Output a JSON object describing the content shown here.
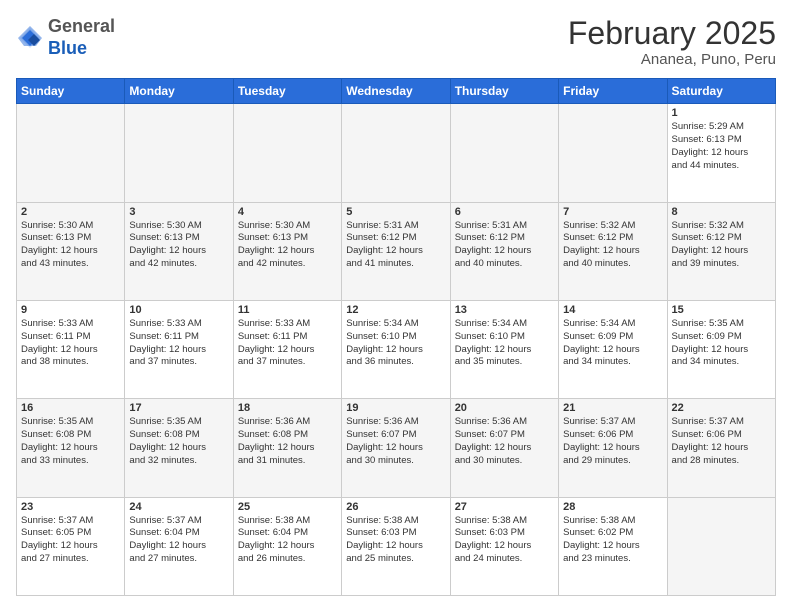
{
  "header": {
    "logo": {
      "general": "General",
      "blue": "Blue"
    },
    "title": "February 2025",
    "location": "Ananea, Puno, Peru"
  },
  "weekdays": [
    "Sunday",
    "Monday",
    "Tuesday",
    "Wednesday",
    "Thursday",
    "Friday",
    "Saturday"
  ],
  "weeks": [
    [
      {
        "day": "",
        "info": ""
      },
      {
        "day": "",
        "info": ""
      },
      {
        "day": "",
        "info": ""
      },
      {
        "day": "",
        "info": ""
      },
      {
        "day": "",
        "info": ""
      },
      {
        "day": "",
        "info": ""
      },
      {
        "day": "1",
        "info": "Sunrise: 5:29 AM\nSunset: 6:13 PM\nDaylight: 12 hours\nand 44 minutes."
      }
    ],
    [
      {
        "day": "2",
        "info": "Sunrise: 5:30 AM\nSunset: 6:13 PM\nDaylight: 12 hours\nand 43 minutes."
      },
      {
        "day": "3",
        "info": "Sunrise: 5:30 AM\nSunset: 6:13 PM\nDaylight: 12 hours\nand 42 minutes."
      },
      {
        "day": "4",
        "info": "Sunrise: 5:30 AM\nSunset: 6:13 PM\nDaylight: 12 hours\nand 42 minutes."
      },
      {
        "day": "5",
        "info": "Sunrise: 5:31 AM\nSunset: 6:12 PM\nDaylight: 12 hours\nand 41 minutes."
      },
      {
        "day": "6",
        "info": "Sunrise: 5:31 AM\nSunset: 6:12 PM\nDaylight: 12 hours\nand 40 minutes."
      },
      {
        "day": "7",
        "info": "Sunrise: 5:32 AM\nSunset: 6:12 PM\nDaylight: 12 hours\nand 40 minutes."
      },
      {
        "day": "8",
        "info": "Sunrise: 5:32 AM\nSunset: 6:12 PM\nDaylight: 12 hours\nand 39 minutes."
      }
    ],
    [
      {
        "day": "9",
        "info": "Sunrise: 5:33 AM\nSunset: 6:11 PM\nDaylight: 12 hours\nand 38 minutes."
      },
      {
        "day": "10",
        "info": "Sunrise: 5:33 AM\nSunset: 6:11 PM\nDaylight: 12 hours\nand 37 minutes."
      },
      {
        "day": "11",
        "info": "Sunrise: 5:33 AM\nSunset: 6:11 PM\nDaylight: 12 hours\nand 37 minutes."
      },
      {
        "day": "12",
        "info": "Sunrise: 5:34 AM\nSunset: 6:10 PM\nDaylight: 12 hours\nand 36 minutes."
      },
      {
        "day": "13",
        "info": "Sunrise: 5:34 AM\nSunset: 6:10 PM\nDaylight: 12 hours\nand 35 minutes."
      },
      {
        "day": "14",
        "info": "Sunrise: 5:34 AM\nSunset: 6:09 PM\nDaylight: 12 hours\nand 34 minutes."
      },
      {
        "day": "15",
        "info": "Sunrise: 5:35 AM\nSunset: 6:09 PM\nDaylight: 12 hours\nand 34 minutes."
      }
    ],
    [
      {
        "day": "16",
        "info": "Sunrise: 5:35 AM\nSunset: 6:08 PM\nDaylight: 12 hours\nand 33 minutes."
      },
      {
        "day": "17",
        "info": "Sunrise: 5:35 AM\nSunset: 6:08 PM\nDaylight: 12 hours\nand 32 minutes."
      },
      {
        "day": "18",
        "info": "Sunrise: 5:36 AM\nSunset: 6:08 PM\nDaylight: 12 hours\nand 31 minutes."
      },
      {
        "day": "19",
        "info": "Sunrise: 5:36 AM\nSunset: 6:07 PM\nDaylight: 12 hours\nand 30 minutes."
      },
      {
        "day": "20",
        "info": "Sunrise: 5:36 AM\nSunset: 6:07 PM\nDaylight: 12 hours\nand 30 minutes."
      },
      {
        "day": "21",
        "info": "Sunrise: 5:37 AM\nSunset: 6:06 PM\nDaylight: 12 hours\nand 29 minutes."
      },
      {
        "day": "22",
        "info": "Sunrise: 5:37 AM\nSunset: 6:06 PM\nDaylight: 12 hours\nand 28 minutes."
      }
    ],
    [
      {
        "day": "23",
        "info": "Sunrise: 5:37 AM\nSunset: 6:05 PM\nDaylight: 12 hours\nand 27 minutes."
      },
      {
        "day": "24",
        "info": "Sunrise: 5:37 AM\nSunset: 6:04 PM\nDaylight: 12 hours\nand 27 minutes."
      },
      {
        "day": "25",
        "info": "Sunrise: 5:38 AM\nSunset: 6:04 PM\nDaylight: 12 hours\nand 26 minutes."
      },
      {
        "day": "26",
        "info": "Sunrise: 5:38 AM\nSunset: 6:03 PM\nDaylight: 12 hours\nand 25 minutes."
      },
      {
        "day": "27",
        "info": "Sunrise: 5:38 AM\nSunset: 6:03 PM\nDaylight: 12 hours\nand 24 minutes."
      },
      {
        "day": "28",
        "info": "Sunrise: 5:38 AM\nSunset: 6:02 PM\nDaylight: 12 hours\nand 23 minutes."
      },
      {
        "day": "",
        "info": ""
      }
    ]
  ]
}
